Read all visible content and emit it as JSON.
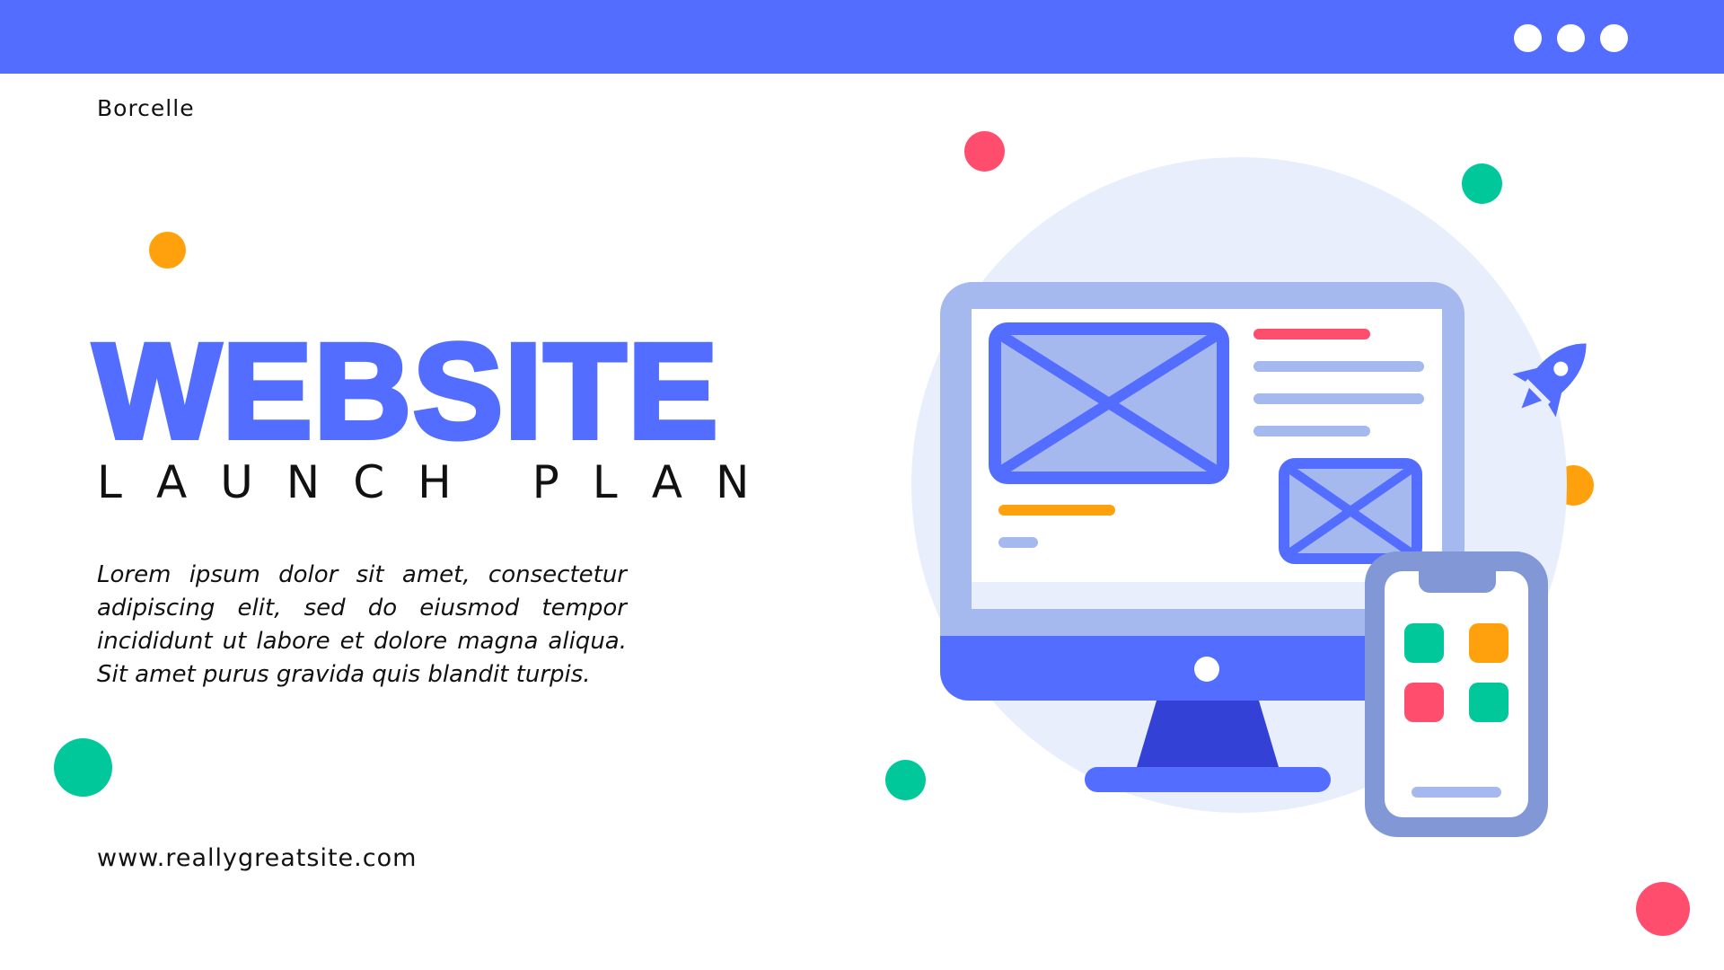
{
  "brand": {
    "name": "Borcelle"
  },
  "hero": {
    "title": "WEBSITE",
    "subtitle": "LAUNCH PLAN",
    "body": "Lorem ipsum dolor sit amet, consectetur adipiscing elit, sed do eiusmod tempor incididunt ut labore et dolore magna aliqua. Sit amet purus gravida quis blandit turpis."
  },
  "footer": {
    "url": "www.reallygreatsite.com"
  },
  "colors": {
    "primary": "#526dff",
    "primary_dark": "#3341d6",
    "light_blue": "#a6b9ee",
    "bg_circle": "#e8eefc",
    "red": "#ff4d6d",
    "green": "#00c89b",
    "orange": "#ffa10c"
  },
  "icons": [
    "window-dot-icon",
    "envelope-icon",
    "rocket-icon",
    "monitor-icon",
    "smartphone-icon",
    "app-tile-icon"
  ]
}
